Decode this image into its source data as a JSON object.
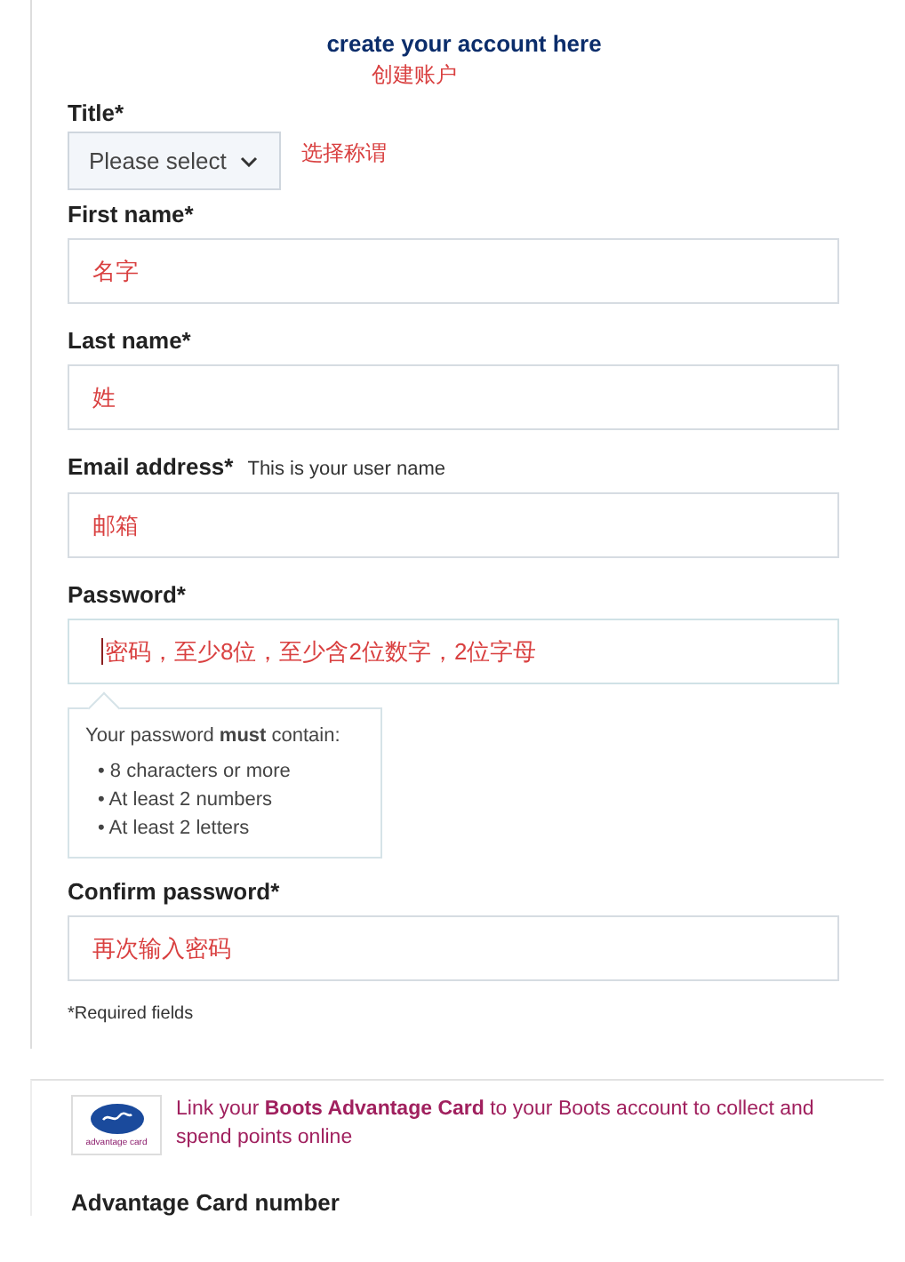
{
  "heading": "create your account here",
  "heading_note": "创建账户",
  "title_field": {
    "label": "Title*",
    "value": "Please select",
    "note": "选择称谓"
  },
  "fields": [
    {
      "label": "First name*",
      "value": "名字"
    },
    {
      "label": "Last name*",
      "value": "姓"
    },
    {
      "label": "Email address*",
      "hint": "This is your user name",
      "value": "邮箱"
    },
    {
      "label": "Password*",
      "value": "密码，至少8位，至少含2位数字，2位字母",
      "focused": true,
      "tooltip": {
        "intro": "Your password **must** contain:",
        "rules": [
          "• 8 characters or more",
          "• At least 2 numbers",
          "• At least 2 letters"
        ]
      }
    },
    {
      "label": "Confirm password*",
      "value": "再次输入密码"
    }
  ],
  "required_note": "*Required fields",
  "advantage": {
    "logo_caption": "advantage card",
    "text": "Link your **Boots Advantage Card** to your Boots account to collect and spend points online",
    "field_label": "Advantage Card number"
  }
}
